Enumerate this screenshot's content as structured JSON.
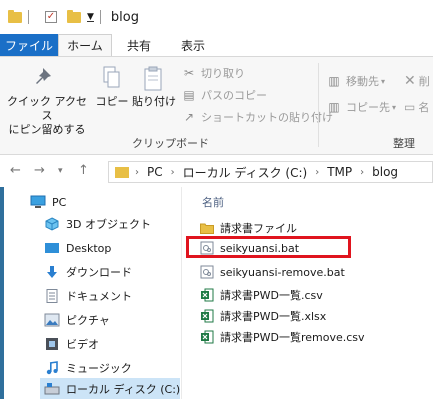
{
  "window": {
    "title": "blog"
  },
  "ribbon_tabs": [
    "ファイル",
    "ホーム",
    "共有",
    "表示"
  ],
  "ribbon": {
    "quick_access_label": "クイック アクセス\nにピン留めする",
    "copy_label": "コピー",
    "paste_label": "貼り付け",
    "cut_label": "切り取り",
    "copy_path_label": "パスのコピー",
    "paste_shortcut_label": "ショートカットの貼り付け",
    "clipboard_group": "クリップボード",
    "move_to_label": "移動先",
    "copy_to_label": "コピー先",
    "organize_group": "整理",
    "delete_label": "削",
    "rename_label": "名"
  },
  "address": {
    "crumbs": [
      "PC",
      "ローカル ディスク (C:)",
      "TMP",
      "blog"
    ]
  },
  "nav": {
    "items": [
      {
        "label": "PC",
        "icon": "pc-icon"
      },
      {
        "label": "3D オブジェクト",
        "icon": "3d-objects-icon"
      },
      {
        "label": "Desktop",
        "icon": "desktop-icon"
      },
      {
        "label": "ダウンロード",
        "icon": "download-icon"
      },
      {
        "label": "ドキュメント",
        "icon": "documents-icon"
      },
      {
        "label": "ピクチャ",
        "icon": "pictures-icon"
      },
      {
        "label": "ビデオ",
        "icon": "videos-icon"
      },
      {
        "label": "ミュージック",
        "icon": "music-icon"
      },
      {
        "label": "ローカル ディスク (C:)",
        "icon": "drive-icon"
      }
    ]
  },
  "files": {
    "column_name": "名前",
    "items": [
      {
        "name": "請求書ファイル",
        "type": "folder"
      },
      {
        "name": "seikyuansi.bat",
        "type": "bat"
      },
      {
        "name": "seikyuansi-remove.bat",
        "type": "bat"
      },
      {
        "name": "請求書PWD一覧.csv",
        "type": "excel"
      },
      {
        "name": "請求書PWD一覧.xlsx",
        "type": "excel"
      },
      {
        "name": "請求書PWD一覧remove.csv",
        "type": "excel"
      }
    ]
  },
  "colors": {
    "file_tab": "#1a6fc7",
    "highlight": "#e0141e",
    "folder": "#e8bf45",
    "excel": "#1f7a45",
    "nav_selected": "#cce4f7"
  }
}
